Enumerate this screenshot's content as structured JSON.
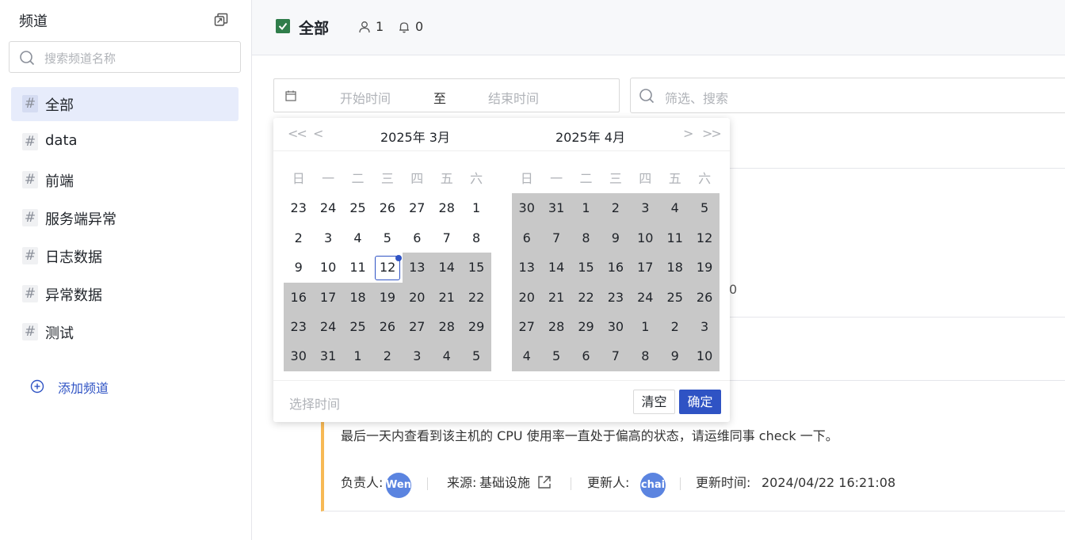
{
  "sidebar": {
    "title": "频道",
    "search_placeholder": "搜索频道名称",
    "items": [
      {
        "label": "全部",
        "active": true
      },
      {
        "label": "data"
      },
      {
        "label": "前端"
      },
      {
        "label": "服务端异常"
      },
      {
        "label": "日志数据"
      },
      {
        "label": "异常数据"
      },
      {
        "label": "测试"
      }
    ],
    "add_label": "添加频道"
  },
  "header": {
    "title": "全部",
    "member_count": "1",
    "notification_count": "0"
  },
  "filters": {
    "start_placeholder": "开始时间",
    "separator": "至",
    "end_placeholder": "结束时间",
    "search_placeholder": "筛选、搜索"
  },
  "background": {
    "partial_text": "0"
  },
  "card": {
    "description": "最后一天内查看到该主机的 CPU 使用率一直处于偏高的状态，请运维同事 check 一下。",
    "owner_label": "负责人:",
    "owner_avatar": "Wend",
    "source_label": "来源:",
    "source_value": "基础设施",
    "updater_label": "更新人:",
    "updater_avatar": "chai",
    "updated_time_label": "更新时间:",
    "updated_time_value": "2024/04/22 16:21:08",
    "accent_color": "#f7b955"
  },
  "picker": {
    "left_month": "2025年 3月",
    "right_month": "2025年 4月",
    "weekdays": [
      "日",
      "一",
      "二",
      "三",
      "四",
      "五",
      "六"
    ],
    "left_days": [
      [
        "23",
        "24",
        "25",
        "26",
        "27",
        "28",
        "1"
      ],
      [
        "2",
        "3",
        "4",
        "5",
        "6",
        "7",
        "8"
      ],
      [
        "9",
        "10",
        "11",
        "12",
        "13",
        "14",
        "15"
      ],
      [
        "16",
        "17",
        "18",
        "19",
        "20",
        "21",
        "22"
      ],
      [
        "23",
        "24",
        "25",
        "26",
        "27",
        "28",
        "29"
      ],
      [
        "30",
        "31",
        "1",
        "2",
        "3",
        "4",
        "5"
      ]
    ],
    "right_days": [
      [
        "30",
        "31",
        "1",
        "2",
        "3",
        "4",
        "5"
      ],
      [
        "6",
        "7",
        "8",
        "9",
        "10",
        "11",
        "12"
      ],
      [
        "13",
        "14",
        "15",
        "16",
        "17",
        "18",
        "19"
      ],
      [
        "20",
        "21",
        "22",
        "23",
        "24",
        "25",
        "26"
      ],
      [
        "27",
        "28",
        "29",
        "30",
        "1",
        "2",
        "3"
      ],
      [
        "4",
        "5",
        "6",
        "7",
        "8",
        "9",
        "10"
      ]
    ],
    "today": "12",
    "footer_placeholder": "选择时间",
    "clear_label": "清空",
    "ok_label": "确定",
    "accent_color": "#2f53c4",
    "highlight_color": "#c8c8c8"
  }
}
